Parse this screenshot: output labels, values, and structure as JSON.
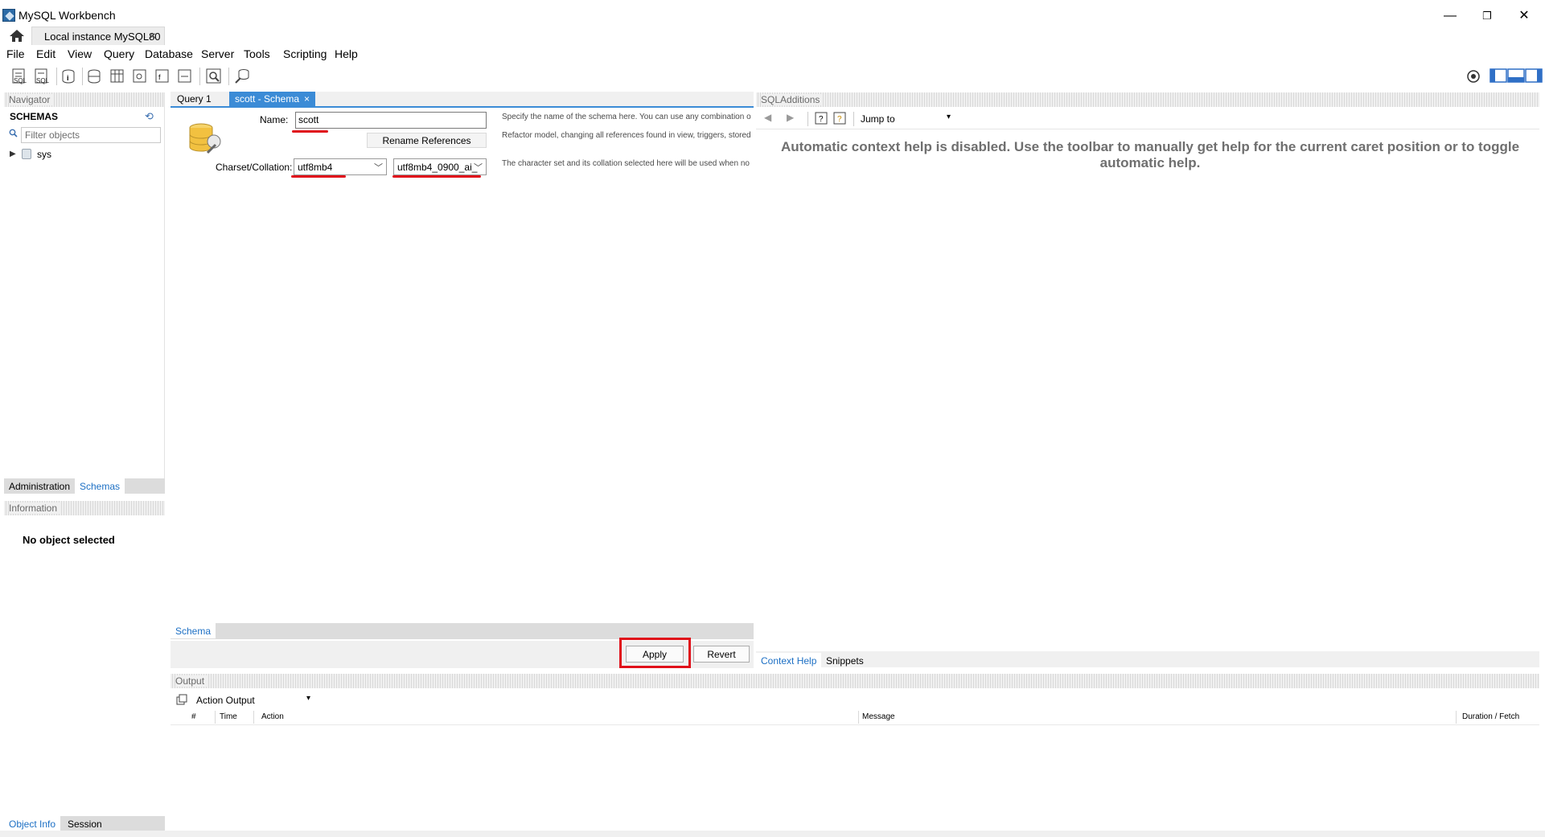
{
  "window": {
    "title": "MySQL Workbench",
    "minimize": "—",
    "restore": "❐",
    "close": "✕"
  },
  "connection_tab": {
    "label": "Local instance MySQL80",
    "close": "×"
  },
  "menu": [
    "File",
    "Edit",
    "View",
    "Query",
    "Database",
    "Server",
    "Tools",
    "Scripting",
    "Help"
  ],
  "navigator": {
    "header": "Navigator",
    "schemas_title": "SCHEMAS",
    "filter_placeholder": "Filter objects",
    "tree": [
      {
        "label": "sys"
      }
    ],
    "tabs": {
      "administration": "Administration",
      "schemas": "Schemas"
    }
  },
  "information": {
    "header": "Information",
    "empty": "No object selected",
    "tabs": {
      "object_info": "Object Info",
      "session": "Session"
    }
  },
  "editor": {
    "tabs": {
      "query": "Query 1",
      "schema": "scott - Schema",
      "close": "×"
    },
    "name_label": "Name:",
    "name_value": "scott",
    "rename_button": "Rename References",
    "charset_label": "Charset/Collation:",
    "charset_value": "utf8mb4",
    "collation_value": "utf8mb4_0900_ai_",
    "hint_name": "Specify the name of the schema here. You can use any combination o",
    "hint_rename": "Refactor model, changing all references found in view, triggers, stored proce",
    "hint_charset": "The character set and its collation selected here will be used when no",
    "bottom_tab": "Schema",
    "apply": "Apply",
    "revert": "Revert"
  },
  "sql_additions": {
    "header": "SQLAdditions",
    "jump_to": "Jump to",
    "help_text": "Automatic context help is disabled. Use the toolbar to manually get help for the current caret position or to toggle automatic help.",
    "tabs": {
      "context_help": "Context Help",
      "snippets": "Snippets"
    }
  },
  "output": {
    "header": "Output",
    "selector": "Action Output",
    "columns": [
      "#",
      "Time",
      "Action",
      "Message",
      "Duration / Fetch"
    ]
  },
  "colors": {
    "accent": "#3b8bd6",
    "highlight": "#e0101a"
  }
}
